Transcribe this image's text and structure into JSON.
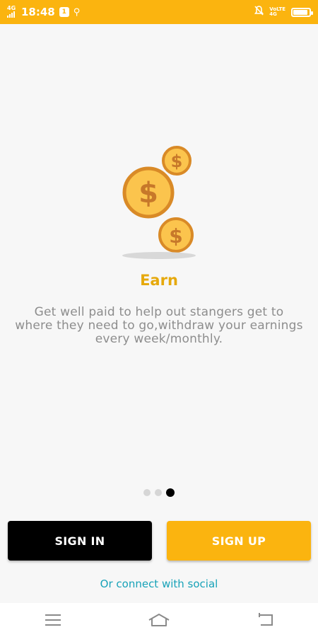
{
  "status_bar": {
    "time": "18:48",
    "network": "4G",
    "volte_top": "VoLTE",
    "volte_bottom": "4G",
    "sim_badge": "1",
    "background": "#fbb40f",
    "icons": [
      "signal-icon",
      "hd-call-icon",
      "usb-icon",
      "mute-icon",
      "battery-icon"
    ]
  },
  "onboarding": {
    "illustration": "coins-icon",
    "title": "Earn",
    "description": "Get well paid to help out stangers get to where they need to go,withdraw your earnings every week/monthly.",
    "page_indicator": {
      "total": 3,
      "active": 3
    }
  },
  "actions": {
    "sign_in_label": "SIGN IN",
    "sign_up_label": "SIGN UP",
    "social_label": "Or connect with social"
  },
  "colors": {
    "accent": "#fbb40f",
    "title": "#e6a90d",
    "link": "#17a2b8",
    "sign_in_bg": "#000000"
  },
  "nav_bar": {
    "icons": [
      "menu-icon",
      "home-icon",
      "back-icon"
    ]
  }
}
